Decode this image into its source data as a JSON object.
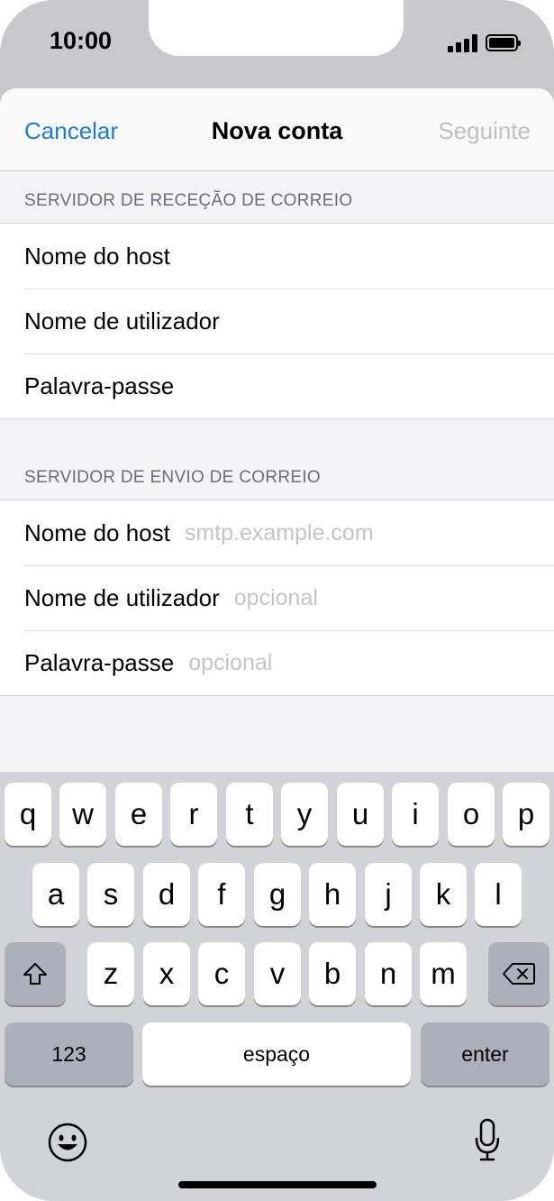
{
  "status_bar": {
    "time": "10:00"
  },
  "nav": {
    "cancel": "Cancelar",
    "title": "Nova conta",
    "next": "Seguinte"
  },
  "incoming": {
    "header": "SERVIDOR DE RECEÇÃO DE CORREIO",
    "rows": [
      {
        "label": "Nome do host",
        "placeholder": ""
      },
      {
        "label": "Nome de utilizador",
        "placeholder": ""
      },
      {
        "label": "Palavra-passe",
        "placeholder": ""
      }
    ]
  },
  "outgoing": {
    "header": "SERVIDOR DE ENVIO DE CORREIO",
    "rows": [
      {
        "label": "Nome do host",
        "placeholder": "smtp.example.com"
      },
      {
        "label": "Nome de utilizador",
        "placeholder": "opcional"
      },
      {
        "label": "Palavra-passe",
        "placeholder": "opcional"
      }
    ]
  },
  "keyboard": {
    "row1": [
      "q",
      "w",
      "e",
      "r",
      "t",
      "y",
      "u",
      "i",
      "o",
      "p"
    ],
    "row2": [
      "a",
      "s",
      "d",
      "f",
      "g",
      "h",
      "j",
      "k",
      "l"
    ],
    "row3": [
      "z",
      "x",
      "c",
      "v",
      "b",
      "n",
      "m"
    ],
    "numbers": "123",
    "space": "espaço",
    "enter": "enter",
    "icons": {
      "shift": "shift-icon",
      "delete": "delete-icon",
      "emoji": "emoji-icon",
      "mic": "microphone-icon"
    }
  },
  "colors": {
    "accent": "#1e7bd6",
    "disabled": "#bfbfc4",
    "placeholder": "#c4c4c7"
  }
}
